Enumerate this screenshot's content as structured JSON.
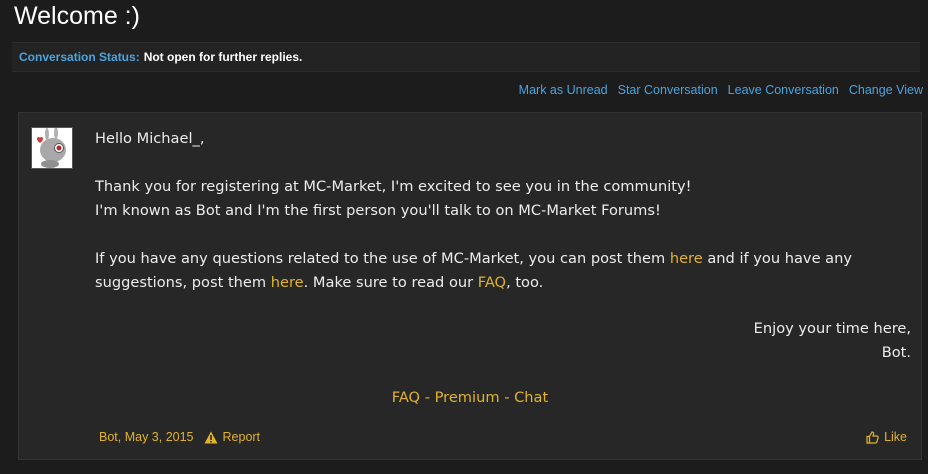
{
  "page": {
    "title": "Welcome :)"
  },
  "status": {
    "label": "Conversation Status:",
    "value": "Not open for further replies."
  },
  "actions": [
    {
      "label": "Mark as Unread"
    },
    {
      "label": "Star Conversation"
    },
    {
      "label": "Leave Conversation"
    },
    {
      "label": "Change View"
    }
  ],
  "message": {
    "greeting": "Hello Michael_,",
    "line1": "Thank you for registering at MC-Market, I'm excited to see you in the community!",
    "line2": "I'm known as Bot and I'm the first person you'll talk to on MC-Market Forums!",
    "p2_a": "If you have any questions related to the use of MC-Market, you can post them ",
    "link_here1": "here",
    "p2_b": " and if you have any suggestions, post them ",
    "link_here2": "here",
    "p2_c": ". Make sure to read our ",
    "link_faq": "FAQ",
    "p2_d": ", too.",
    "closing1": "Enjoy your time here,",
    "closing2": "Bot."
  },
  "signature_links": {
    "faq": "FAQ",
    "sep": " - ",
    "premium": "Premium",
    "chat": "Chat"
  },
  "meta": {
    "author": "Bot",
    "date": ", May 3, 2015",
    "report": "Report",
    "like": "Like"
  },
  "colors": {
    "accent_blue": "#4aa3df",
    "accent_gold": "#e0b32b",
    "background": "#1c1c1c",
    "panel": "#272727"
  },
  "icons": [
    "bot-avatar",
    "warning-icon",
    "thumbs-up-icon"
  ]
}
